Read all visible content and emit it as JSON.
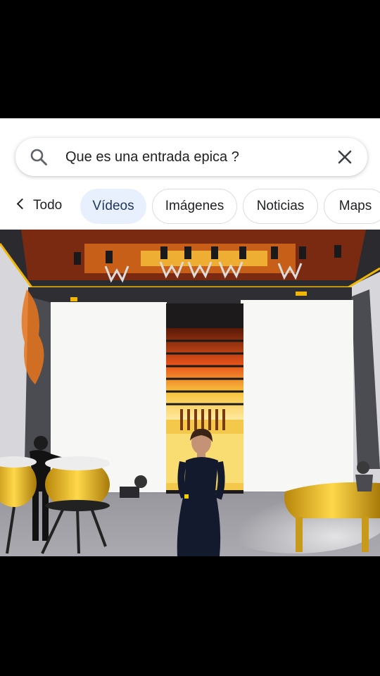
{
  "search": {
    "query": "Que es una entrada epica ?"
  },
  "tabs": {
    "back_label": "Todo",
    "items": [
      {
        "label": "Vídeos",
        "active": true
      },
      {
        "label": "Imágenes",
        "active": false
      },
      {
        "label": "Noticias",
        "active": false
      },
      {
        "label": "Maps",
        "active": false
      }
    ]
  },
  "colors": {
    "active_chip_bg": "#e8f0fe",
    "chip_border": "#dadce0",
    "stage_gold": "#f2b705",
    "dress": "#141a2e"
  },
  "icons": {
    "search": "search-icon",
    "clear": "close-icon",
    "back": "chevron-left-icon"
  }
}
